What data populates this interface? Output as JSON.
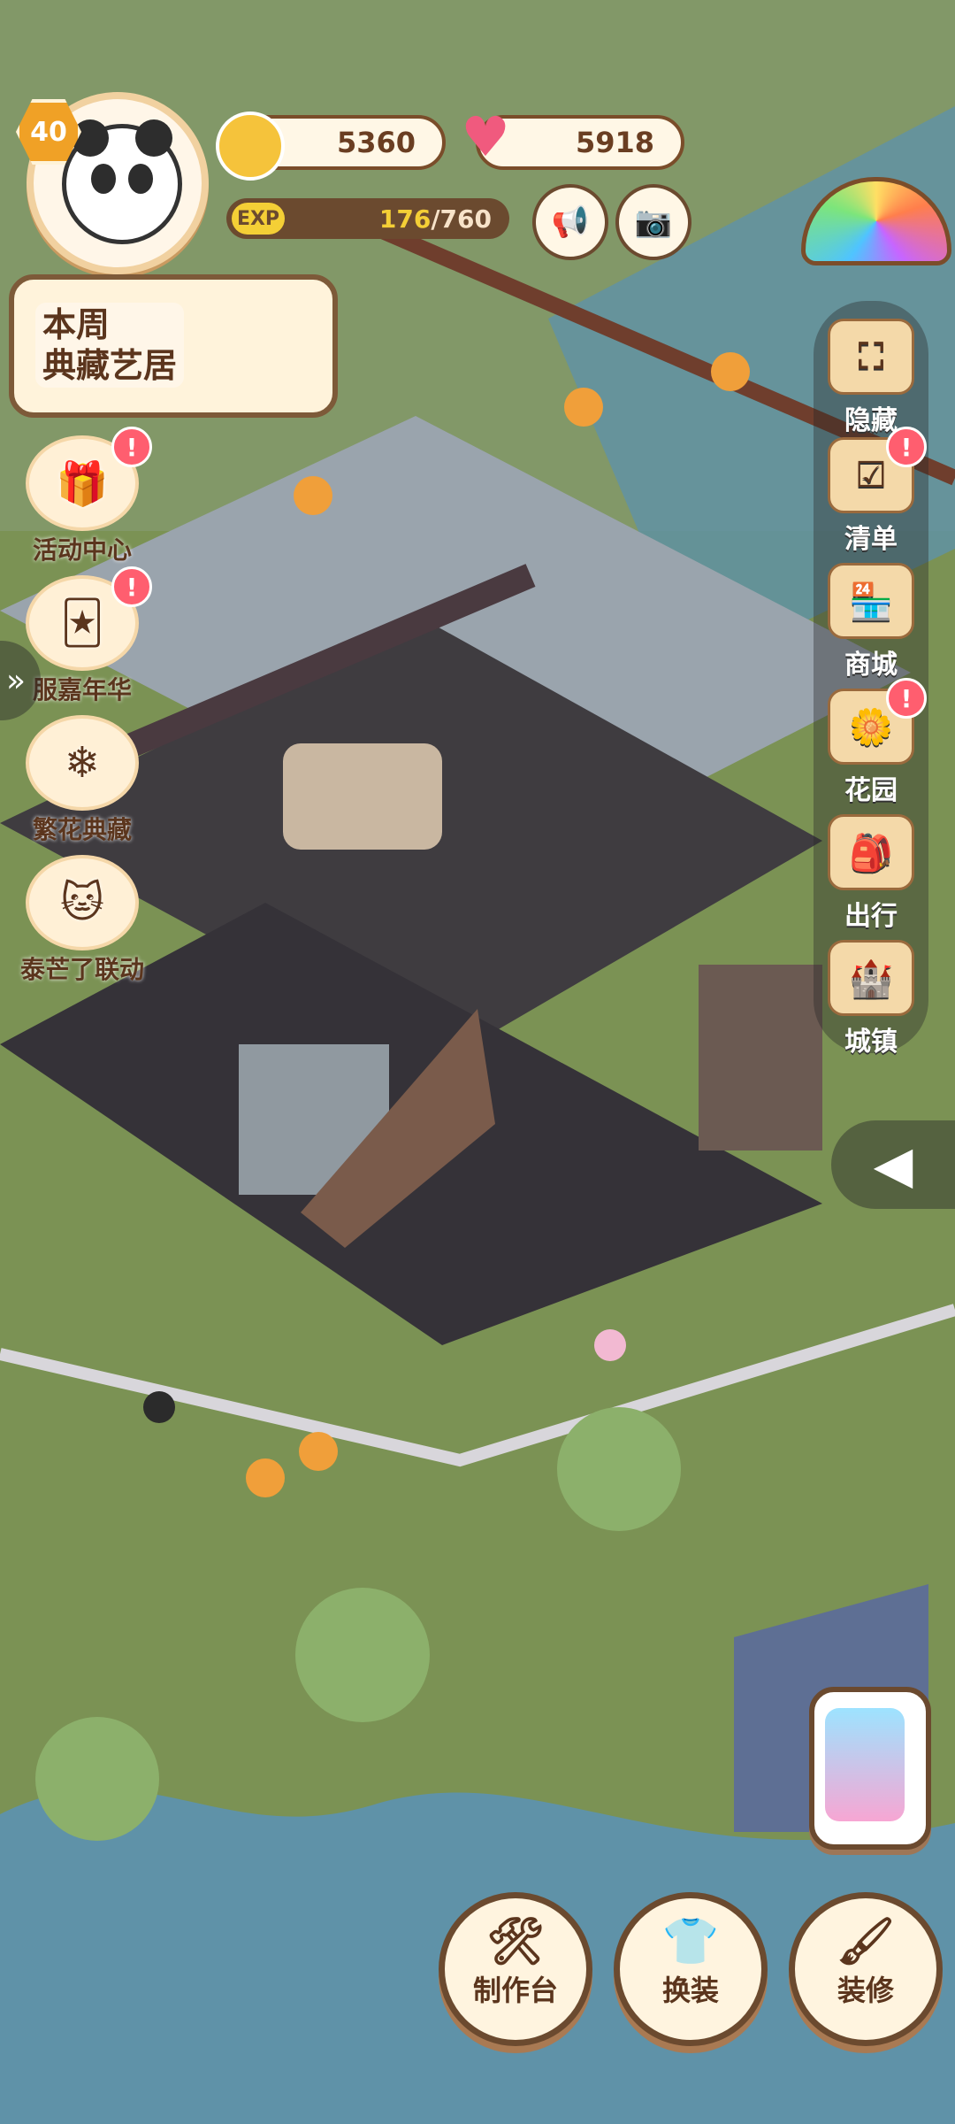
{
  "colors": {
    "water": "#5f92a8",
    "floor": "#3f3c40",
    "wall": "#8e98a2",
    "grass": "#7b9254",
    "lantern": "#f09f3a",
    "coin": "#f5c33b",
    "heart": "#f05a7e"
  },
  "player": {
    "level": "40",
    "avatar_icon": "panda-icon"
  },
  "currency": {
    "coins": "5360",
    "hearts": "5918",
    "coin_icon": "bunny-coin-icon",
    "heart_icon": "heart-icon"
  },
  "exp": {
    "label": "EXP",
    "current": "176",
    "max": "/760"
  },
  "top_buttons": {
    "sound_icon": "megaphone-icon",
    "camera_icon": "camera-icon"
  },
  "banner": {
    "line1": "本周",
    "line2": "典藏艺居"
  },
  "left_menu": [
    {
      "label": "活动中心",
      "icon": "gift-icon",
      "badge": "!"
    },
    {
      "label": "服嘉年华",
      "icon": "jester-icon",
      "badge": "!"
    },
    {
      "label": "繁花典藏",
      "icon": "flower-icon",
      "badge": ""
    },
    {
      "label": "泰芒了联动",
      "icon": "cat-icon",
      "badge": ""
    }
  ],
  "right_menu": [
    {
      "label": "隐藏",
      "icon": "hide-icon",
      "badge": ""
    },
    {
      "label": "清单",
      "icon": "checklist-icon",
      "badge": "!"
    },
    {
      "label": "商城",
      "icon": "shop-icon",
      "badge": ""
    },
    {
      "label": "花园",
      "icon": "garden-icon",
      "badge": "!"
    },
    {
      "label": "出行",
      "icon": "travel-icon",
      "badge": ""
    },
    {
      "label": "城镇",
      "icon": "castle-icon",
      "badge": ""
    }
  ],
  "bottom_buttons": [
    {
      "label": "制作台",
      "icon": "workbench-icon"
    },
    {
      "label": "换装",
      "icon": "outfit-icon"
    },
    {
      "label": "装修",
      "icon": "paint-icon"
    }
  ]
}
